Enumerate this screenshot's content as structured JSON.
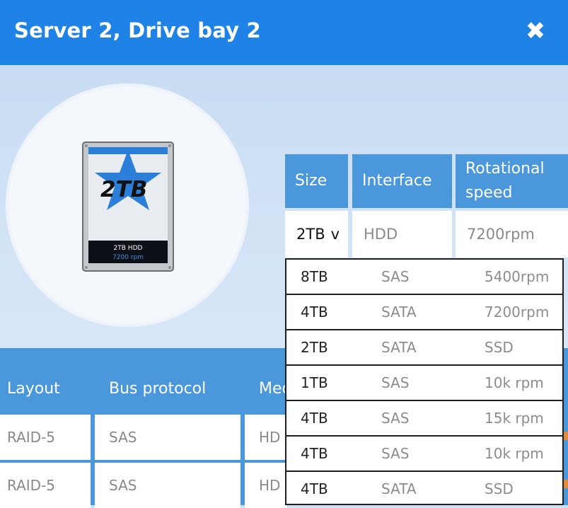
{
  "dialog": {
    "title": "Server 2, Drive bay 2",
    "close_label": "✖"
  },
  "drive_image": {
    "capacity_label": "2TB",
    "model_label": "2TB HDD",
    "rpm_label": "7200 rpm"
  },
  "spec_table": {
    "headers": [
      "Size",
      "Interface",
      "Rotational speed"
    ],
    "header_lines": {
      "rot_1": "Rotational",
      "rot_2": "speed"
    },
    "selected": {
      "size": "2TB",
      "chevron": "v",
      "interface": "HDD",
      "speed": "7200rpm"
    }
  },
  "dropdown_options": [
    {
      "size": "8TB",
      "interface": "SAS",
      "speed": "5400rpm"
    },
    {
      "size": "4TB",
      "interface": "SATA",
      "speed": "7200rpm"
    },
    {
      "size": "2TB",
      "interface": "SATA",
      "speed": "SSD"
    },
    {
      "size": "1TB",
      "interface": "SAS",
      "speed": "10k rpm"
    },
    {
      "size": "4TB",
      "interface": "SAS",
      "speed": "15k rpm"
    },
    {
      "size": "4TB",
      "interface": "SAS",
      "speed": "10k rpm"
    },
    {
      "size": "4TB",
      "interface": "SATA",
      "speed": "SSD"
    }
  ],
  "lower_table": {
    "headers": [
      "Layout",
      "Bus protocol",
      "Med"
    ],
    "rows": [
      {
        "layout": "RAID-5",
        "bus": "SAS",
        "media": "HD"
      },
      {
        "layout": "RAID-5",
        "bus": "SAS",
        "media": "HD"
      }
    ]
  }
}
